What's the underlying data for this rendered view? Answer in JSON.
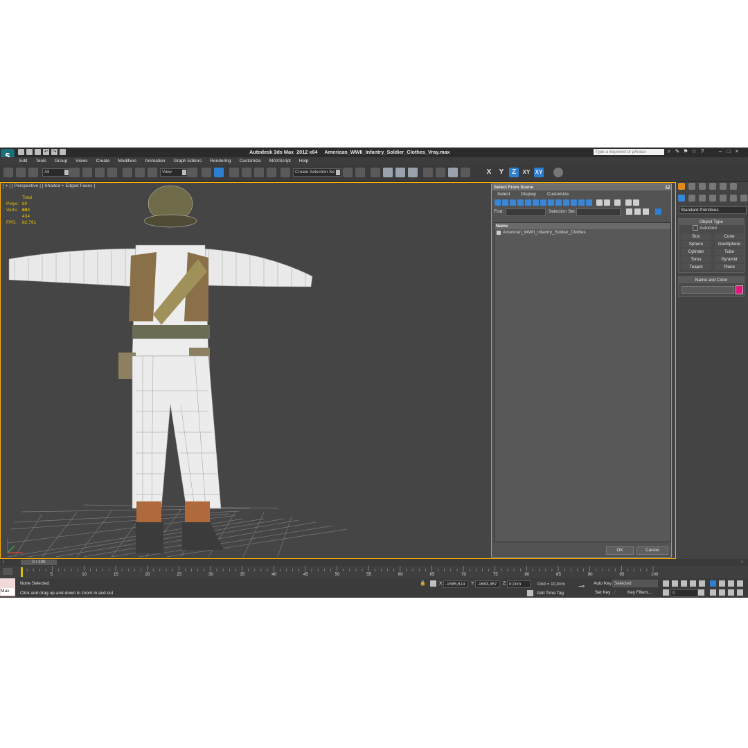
{
  "app": {
    "title": "Autodesk 3ds Max  2012 x64     American_WWII_Infantry_Soldier_Clothes_Vray.max",
    "search_placeholder": "Type a keyword or phrase",
    "menu": [
      "Edit",
      "Tools",
      "Group",
      "Views",
      "Create",
      "Modifiers",
      "Animation",
      "Graph Editors",
      "Rendering",
      "Customize",
      "MAXScript",
      "Help"
    ],
    "accent": "#ffb000",
    "selection_blue": "#2c7fd1"
  },
  "toolbar": {
    "filter_value": "All",
    "view_value": "View",
    "selection_set_placeholder": "Create Selection Se",
    "axes": [
      "X",
      "Y",
      "Z",
      "XY",
      "XY"
    ]
  },
  "viewport": {
    "label": "[ + ] [ Perspective ] [ Shaded + Edged Faces ]",
    "stats": {
      "total_label": "Total",
      "polys_label": "Polys:",
      "polys_value": "80 058",
      "verts_label": "Verts:",
      "verts_value": "42 434",
      "fps_label": "FPS:",
      "fps_value": "82,791"
    }
  },
  "dialog": {
    "title": "Select From Scene",
    "menu": [
      "Select",
      "Display",
      "Customize"
    ],
    "find_label": "Find:",
    "selection_set_label": "Selection Set:",
    "column_header": "Name",
    "items": [
      "American_WWII_Infantry_Soldier_Clothes"
    ],
    "ok_label": "OK",
    "cancel_label": "Cancel"
  },
  "command_panel": {
    "category": "Standard Primitives",
    "object_type_header": "Object Type",
    "autogrid_label": "AutoGrid",
    "objects": [
      "Box",
      "Cone",
      "Sphere",
      "GeoSphere",
      "Cylinder",
      "Tube",
      "Torus",
      "Pyramid",
      "Teapot",
      "Plane"
    ],
    "name_color_header": "Name and Color",
    "object_color": "#e0157a"
  },
  "timeline": {
    "slider_label": "0 / 100",
    "ticks": [
      "0",
      "5",
      "10",
      "15",
      "20",
      "25",
      "30",
      "35",
      "40",
      "45",
      "50",
      "55",
      "60",
      "65",
      "70",
      "75",
      "80",
      "85",
      "90",
      "95",
      "100"
    ]
  },
  "status": {
    "maxscript_label": "Max",
    "selection_status": "None Selected",
    "prompt": "Click and drag up-and-down to zoom in and out",
    "x_label": "X:",
    "x_value": "-1585,614",
    "y_label": "Y:",
    "y_value": "-1683,367",
    "z_label": "Z:",
    "z_value": "0,0cm",
    "grid": "Grid = 10,0cm",
    "add_time_tag": "Add Time Tag",
    "auto_key": "Auto Key",
    "set_key": "Set Key",
    "key_mode": "Selected",
    "key_filters": "Key Filters...",
    "frame": "0"
  }
}
